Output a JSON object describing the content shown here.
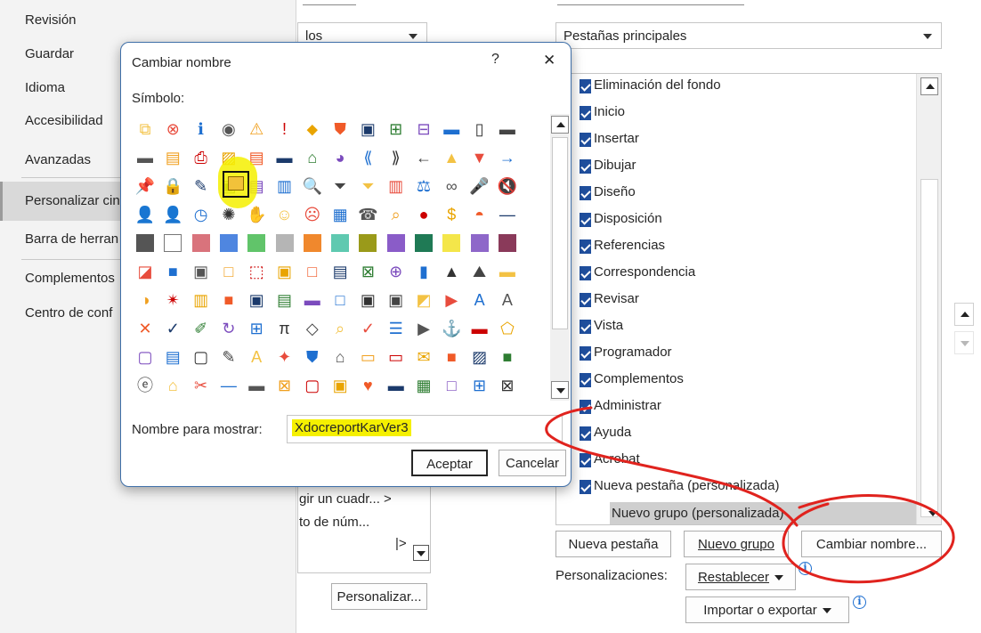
{
  "nav": {
    "items": [
      "Revisión",
      "Guardar",
      "Idioma",
      "Accesibilidad",
      "Avanzadas",
      "Personalizar cinta de opciones",
      "Barra de herramientas de acceso rápido",
      "Complementos",
      "Centro de confianza"
    ],
    "visible_items": [
      "Revisión",
      "Guardar",
      "Idioma",
      "Accesibilidad",
      "Avanzadas",
      "Personalizar cin",
      "Barra de herran",
      "Complementos",
      "Centro de conf"
    ]
  },
  "commands_combo": {
    "value": "los"
  },
  "ribbon_combo": {
    "value": "Pestañas principales"
  },
  "tabs": [
    "Eliminación del fondo",
    "Inicio",
    "Insertar",
    "Dibujar",
    "Diseño",
    "Disposición",
    "Referencias",
    "Correspondencia",
    "Revisar",
    "Vista",
    "Programador",
    "Complementos",
    "Administrar",
    "Ayuda",
    "Acrobat",
    "Nueva pestaña (personalizada)"
  ],
  "new_group": "Nuevo grupo (personalizada)",
  "command_list": [
    "gir un cuadr...  >",
    "to de núm..."
  ],
  "buttons": {
    "new_tab": "Nueva pestaña",
    "new_group": "Nuevo grupo",
    "rename": "Cambiar nombre...",
    "customize": "Personalizar...",
    "reset": "Restablecer",
    "import_export": "Importar o exportar"
  },
  "customizations_label": "Personalizaciones:",
  "dialog": {
    "title": "Cambiar nombre",
    "help": "?",
    "close": "✕",
    "symbol_label": "Símbolo:",
    "display_name_label": "Nombre para mostrar:",
    "display_name_value": "XdocreportKarVer3",
    "accept": "Aceptar",
    "cancel": "Cancelar",
    "symbol_rows": [
      [
        "⧉",
        "⊗",
        "ℹ",
        "◉",
        "⚠",
        "!",
        "⬥",
        "⛊",
        "▣",
        "⊞",
        "⊟",
        "▬",
        "▯",
        "▬"
      ],
      [
        "▬",
        "▤",
        "⎙",
        "▨",
        "▤",
        "▬",
        "⌂",
        "◕",
        "⟪",
        "⟫",
        "←",
        "▲",
        "▼",
        "→"
      ],
      [
        "📌",
        "🔒",
        "✎",
        "▣",
        "▤",
        "▥",
        "🔍",
        "⏷",
        "⏷",
        "▥",
        "⚖",
        "∞",
        "🎤",
        "🔇"
      ],
      [
        "👤",
        "👤",
        "◷",
        "✺",
        "✋",
        "☺",
        "☹",
        "▦",
        "☎",
        "⌕",
        "●",
        "$",
        "◓",
        "—"
      ],
      [
        "▦",
        "□",
        "■",
        "■",
        "■",
        "■",
        "■",
        "■",
        "■",
        "■",
        "■",
        "■",
        "■",
        "■"
      ],
      [
        "◪",
        "■",
        "▣",
        "□",
        "⬚",
        "▣",
        "□",
        "▤",
        "⊠",
        "⊕",
        "▮",
        "▲",
        "⛰",
        "▬"
      ],
      [
        "◑",
        "✴",
        "▥",
        "■",
        "▣",
        "▤",
        "▬",
        "□",
        "▣",
        "▣",
        "◩",
        "▶",
        "A",
        "A"
      ],
      [
        "✕",
        "✓",
        "✐",
        "↻",
        "⊞",
        "π",
        "◇",
        "⌕",
        "✓",
        "☰",
        "▶",
        "⚓",
        "▬",
        "⬠"
      ],
      [
        "▢",
        "▤",
        "▢",
        "✎",
        "A",
        "✦",
        "⛊",
        "⌂",
        "▭",
        "▭",
        "✉",
        "■",
        "▨",
        "■"
      ],
      [
        "ⓔ",
        "⌂",
        "✂",
        "—",
        "▬",
        "⊠",
        "▢",
        "▣",
        "♥",
        "▬",
        "▦",
        "□",
        "⊞",
        "⊠"
      ]
    ]
  },
  "colors": {
    "accent": "#1f4e9c",
    "highlight": "#f5f000",
    "ink": "#e0231e",
    "dialog_border": "#3f6fa8"
  }
}
